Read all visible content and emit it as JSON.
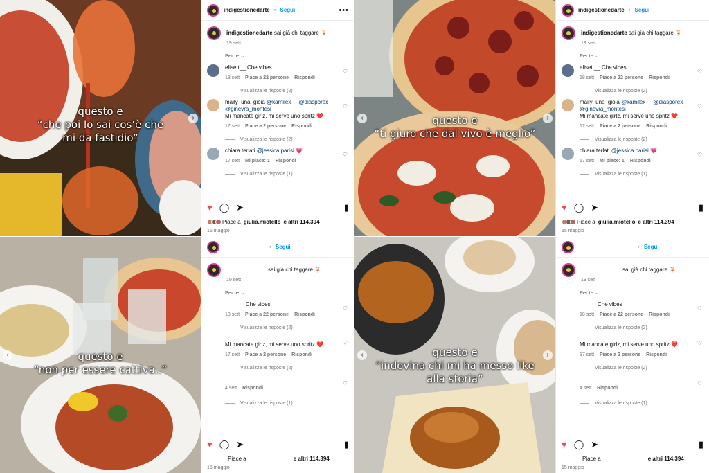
{
  "posts": [
    {
      "username": "indigestionedarte",
      "follow": "Segui",
      "overlay": [
        "questo e",
        "“che poi lo sai cos’è che",
        "mi da fastidio”"
      ],
      "caption": {
        "user": "indigestionedarte",
        "text": "sai già chi taggare 🍹",
        "time": "19 sett"
      },
      "per_te": "Per te ⌄",
      "comments": [
        {
          "user": "elisett__",
          "text": "Che vibes",
          "time": "18 sett",
          "likes": "Piace a 22 persone",
          "reply": "Rispondi",
          "replies": "Visualizza le risposte (2)"
        },
        {
          "user": "maily_una_gioia",
          "mention": "@kamilex__ @diasporex @ginevra_montesi",
          "text": "Mi mancate girlz, mi serve uno spritz ❤️",
          "time": "17 sett",
          "likes": "Piace a 2 persone",
          "reply": "Rispondi",
          "replies": "Visualizza le risposte (2)"
        },
        {
          "user": "chiara.terlati",
          "mention": "@jessica.parisi 💗",
          "text": "",
          "time": "17 sett",
          "likes": "Mi piace: 1",
          "reply": "Rispondi",
          "replies": "Visualizza le risposte (1)"
        }
      ],
      "liked_by_prefix": "Piace a",
      "liked_by_user": "giulia.miotello",
      "liked_by_suffix": "e altri 114.394",
      "date": "15 maggio"
    },
    {
      "username": "indigestionedarte",
      "follow": "Segui",
      "overlay": [
        "questo e",
        "“ti giuro che dal vivo è meglio”"
      ],
      "caption": {
        "user": "indigestionedarte",
        "text": "sai già chi taggare 🍹",
        "time": "19 sett"
      },
      "per_te": "Per te ⌄",
      "comments": [
        {
          "user": "elisett__",
          "text": "Che vibes",
          "time": "18 sett",
          "likes": "Piace a 22 persone",
          "reply": "Rispondi",
          "replies": "Visualizza le risposte (2)"
        },
        {
          "user": "maily_una_gioia",
          "mention": "@kamilex__ @diasporex @ginevra_montesi",
          "text": "Mi mancate girlz, mi serve uno spritz ❤️",
          "time": "17 sett",
          "likes": "Piace a 2 persone",
          "reply": "Rispondi",
          "replies": "Visualizza le risposte (2)"
        },
        {
          "user": "chiara.terlati",
          "mention": "@jessica.parisi 💗",
          "text": "",
          "time": "17 sett",
          "likes": "Mi piace: 1",
          "reply": "Rispondi",
          "replies": "Visualizza le risposte (1)"
        }
      ],
      "liked_by_prefix": "Piace a",
      "liked_by_user": "giulia.miotello",
      "liked_by_suffix": "e altri 114.394",
      "date": "15 maggio"
    },
    {
      "username": "",
      "follow": "Segui",
      "overlay": [
        "questo e",
        "“non per essere cattiva..”"
      ],
      "caption": {
        "user": "",
        "text": "sai già chi taggare 🍹",
        "time": "19 sett"
      },
      "per_te": "Per te ⌄",
      "comments": [
        {
          "user": "",
          "text": "Che vibes",
          "time": "18 sett",
          "likes": "Piace a 22 persone",
          "reply": "Rispondi",
          "replies": "Visualizza le risposte (2)"
        },
        {
          "user": "",
          "mention": "",
          "text": "Mi mancate girlz, mi serve uno spritz ❤️",
          "time": "17 sett",
          "likes": "Piace a 2 persone",
          "reply": "Rispondi",
          "replies": "Visualizza le risposte (2)"
        },
        {
          "user": "",
          "mention": "",
          "text": "",
          "time": "4 sett",
          "likes": "",
          "reply": "Rispondi",
          "replies": "Visualizza le risposte (1)"
        }
      ],
      "liked_by_prefix": "Piace a",
      "liked_by_user": "",
      "liked_by_suffix": "e altri 114.394",
      "date": "15 maggio"
    },
    {
      "username": "",
      "follow": "Segui",
      "overlay": [
        "questo e",
        "“indovina chi mi ha messo like",
        "alla storia”"
      ],
      "caption": {
        "user": "",
        "text": "sai già chi taggare 🍹",
        "time": "19 sett"
      },
      "per_te": "Per te ⌄",
      "comments": [
        {
          "user": "",
          "text": "Che vibes",
          "time": "18 sett",
          "likes": "Piace a 22 persone",
          "reply": "Rispondi",
          "replies": "Visualizza le risposte (2)"
        },
        {
          "user": "",
          "mention": "",
          "text": "Mi mancate girlz, mi serve uno spritz ❤️",
          "time": "17 sett",
          "likes": "Piace a 2 persone",
          "reply": "Rispondi",
          "replies": "Visualizza le risposte (2)"
        },
        {
          "user": "",
          "mention": "",
          "text": "",
          "time": "4 sett",
          "likes": "",
          "reply": "Rispondi",
          "replies": "Visualizza le risposte (1)"
        }
      ],
      "liked_by_prefix": "Piace a",
      "liked_by_user": "",
      "liked_by_suffix": "e altri 114.394",
      "date": "15 maggio"
    }
  ],
  "icons": {
    "like": "heart-icon",
    "comment": "comment-icon",
    "share": "share-icon",
    "save": "bookmark-icon",
    "more": "more-icon"
  },
  "colors": {
    "accent": "#0095f6",
    "like": "#ed4956"
  }
}
